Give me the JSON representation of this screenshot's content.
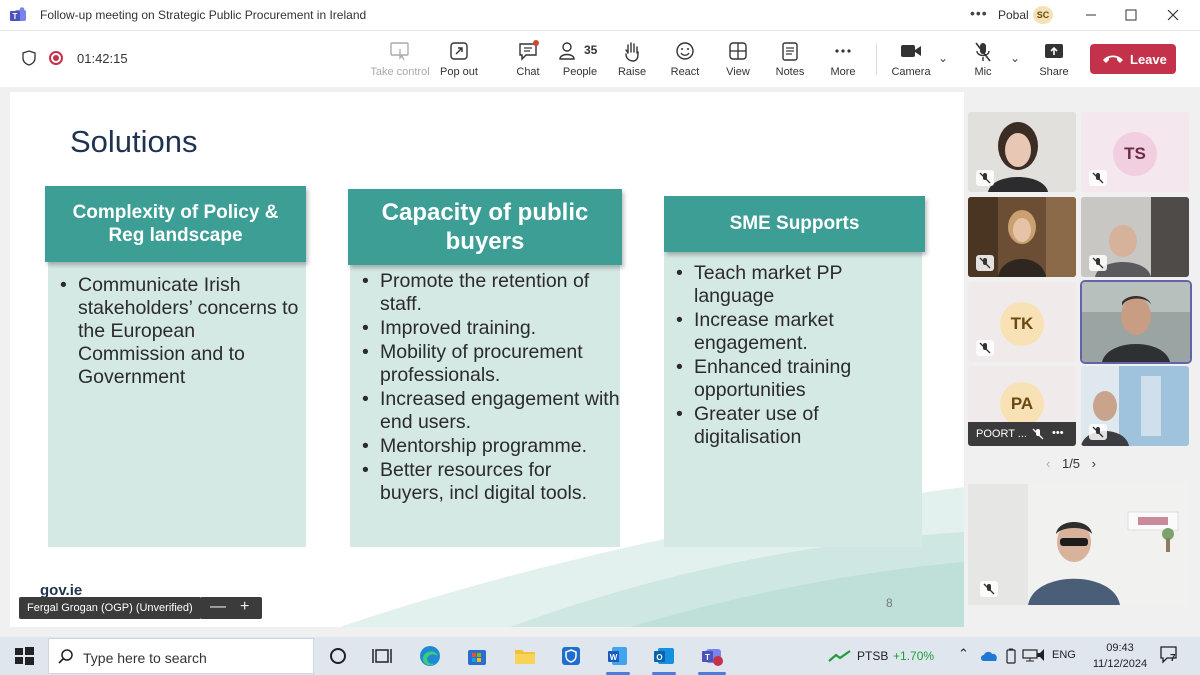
{
  "window": {
    "title": "Follow-up meeting on Strategic Public Procurement in Ireland",
    "more": "•••",
    "user": "Pobal",
    "avatar": "SC"
  },
  "toolbar": {
    "timer": "01:42:15",
    "take_control": "Take control",
    "pop_out": "Pop out",
    "chat": "Chat",
    "people": "People",
    "people_count": "35",
    "raise": "Raise",
    "react": "React",
    "view": "View",
    "notes": "Notes",
    "more": "More",
    "camera": "Camera",
    "mic": "Mic",
    "share": "Share",
    "leave": "Leave",
    "leave_color": "#c4314b"
  },
  "slide": {
    "title": "Solutions",
    "columns": [
      {
        "heading": "Complexity of Policy & Reg landscape",
        "bullets": [
          "Communicate Irish stakeholders’ concerns to the European Commission and to Government"
        ]
      },
      {
        "heading": "Capacity of public buyers",
        "bullets": [
          "Promote the retention of staff.",
          "Improved training.",
          "Mobility of procurement professionals.",
          "Increased engagement with end users.",
          "Mentorship programme.",
          "Better resources for buyers, incl digital tools."
        ]
      },
      {
        "heading": "SME Supports",
        "bullets": [
          "Teach market PP language",
          "Increase market engagement.",
          "Enhanced training opportunities",
          "Greater use of digitalisation"
        ]
      }
    ],
    "footer_logo": "gov.ie",
    "page_number": "8",
    "accent": "#3d9e95",
    "body_bg": "#d4e8e4"
  },
  "presenter": {
    "name": "Fergal Grogan (OGP) (Unverified)",
    "zoom_out": "—",
    "zoom_in": "+"
  },
  "gallery": {
    "tiles": [
      {
        "initials": ""
      },
      {
        "initials": "TS"
      },
      {
        "initials": ""
      },
      {
        "initials": ""
      },
      {
        "initials": "TK"
      },
      {
        "initials": ""
      },
      {
        "initials": "PA",
        "name": "POORT ...",
        "more": "•••"
      },
      {
        "initials": ""
      }
    ],
    "page": "1/5"
  },
  "taskbar": {
    "search_placeholder": "Type here to search",
    "stock_name": "PTSB",
    "stock_change": "+1.70%",
    "language": "ENG",
    "time": "09:43",
    "date": "11/12/2024",
    "notifications": "7"
  }
}
